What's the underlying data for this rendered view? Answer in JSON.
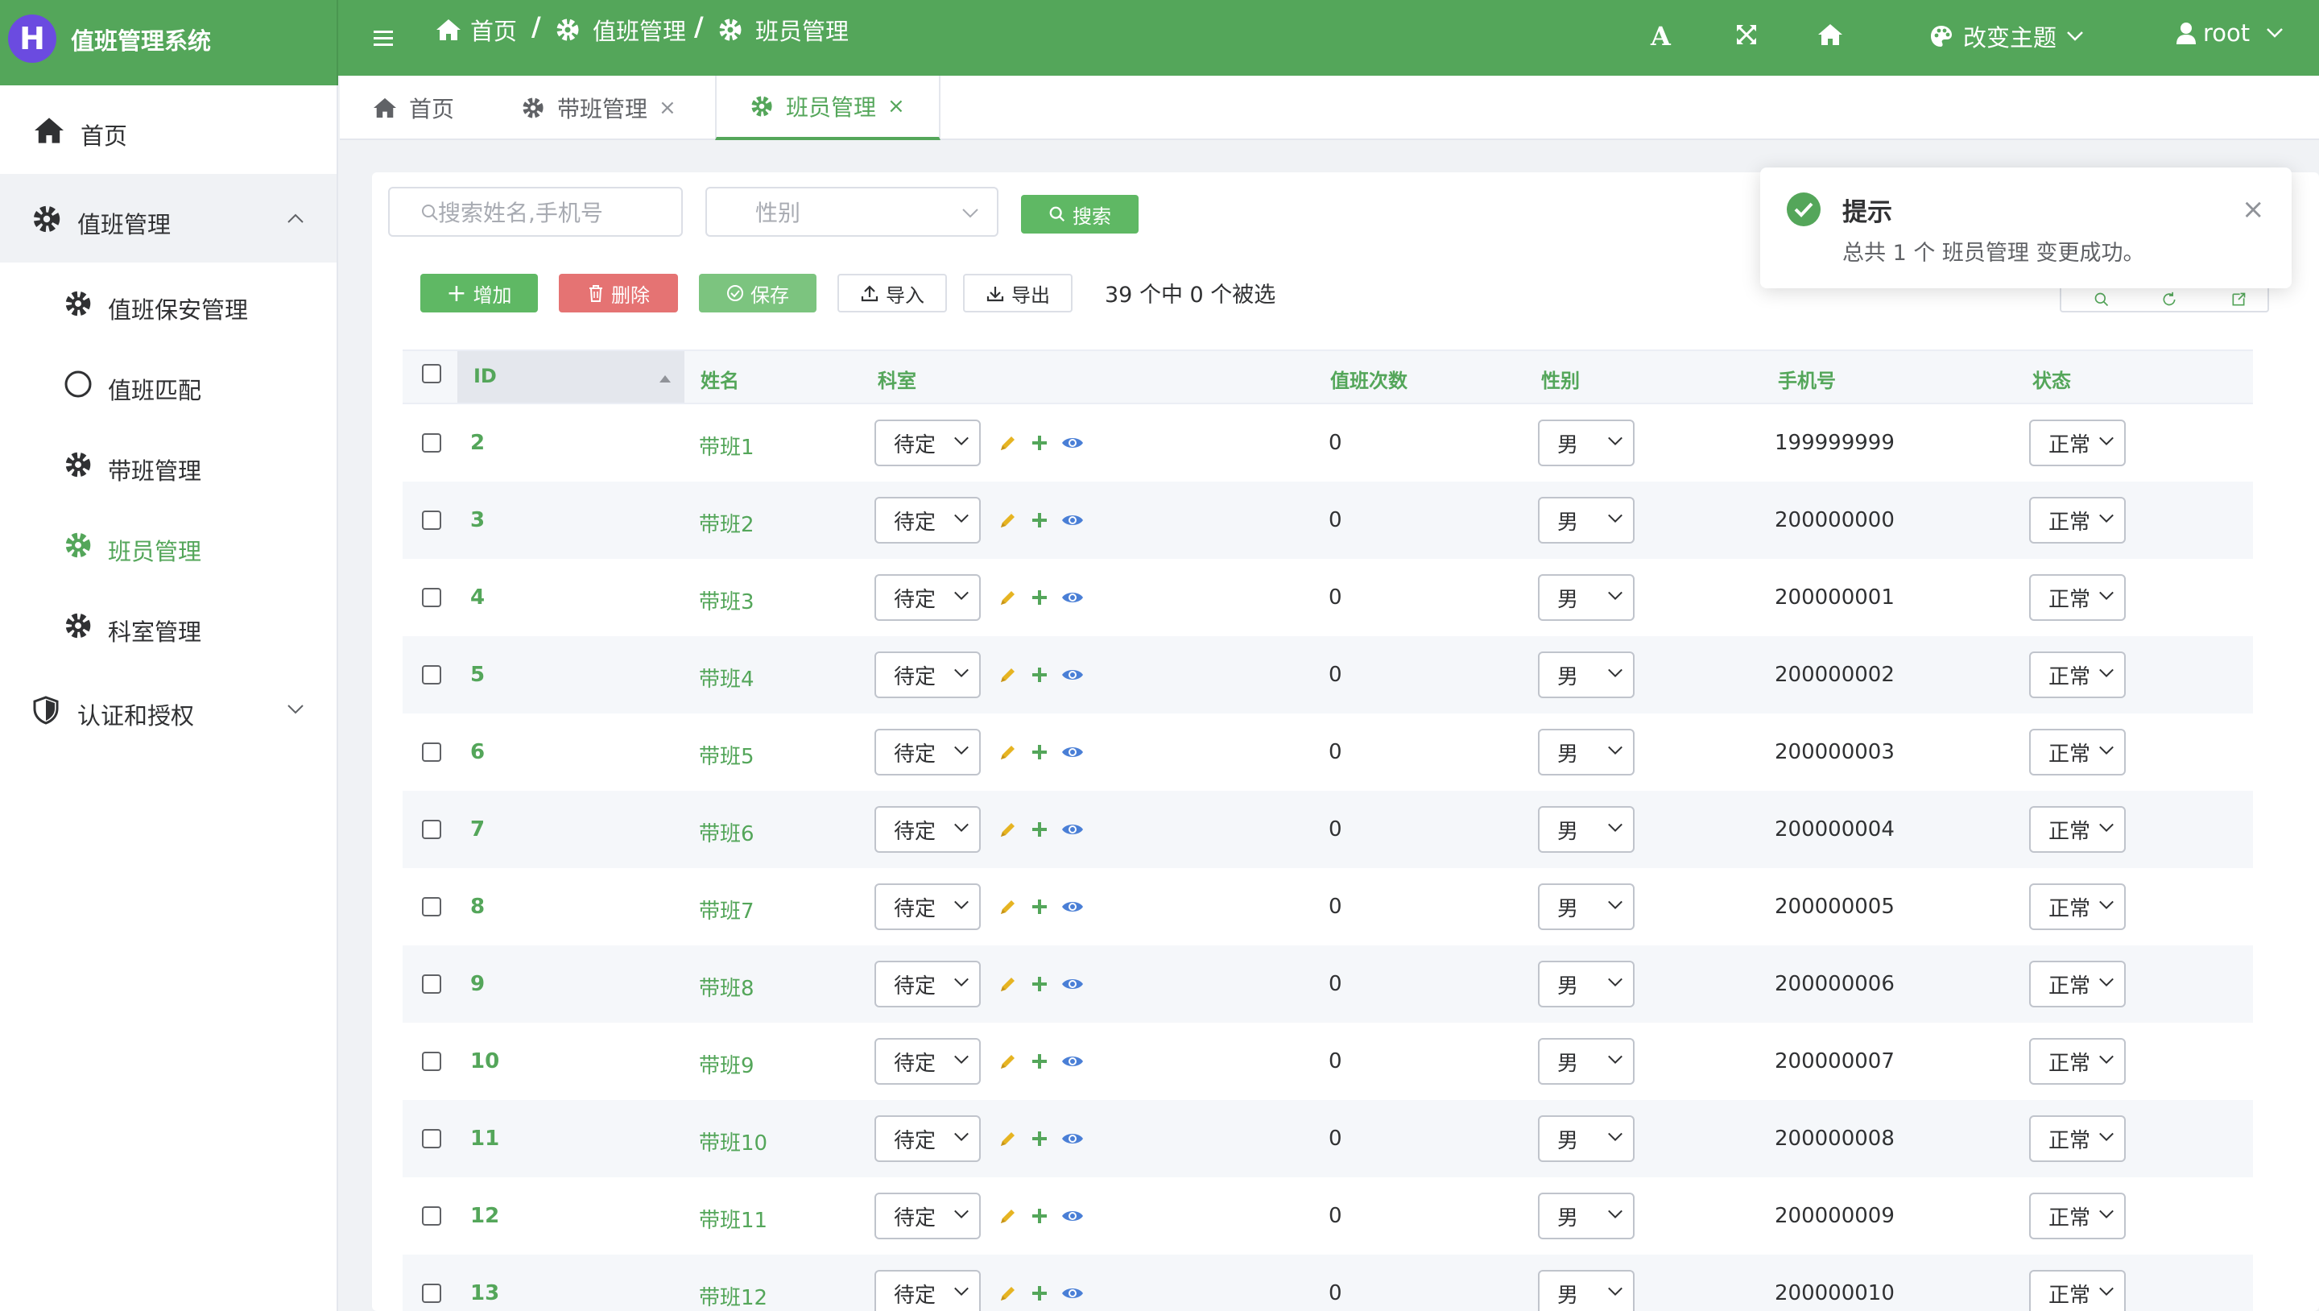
{
  "app": {
    "logo_letter": "H",
    "title": "值班管理系统"
  },
  "header": {
    "breadcrumb": [
      "首页",
      "值班管理",
      "班员管理"
    ],
    "breadcrumb_sep": "/",
    "font_icon_label": "A",
    "theme_label": "改变主题",
    "user_label": "root"
  },
  "sidebar": {
    "home": "首页",
    "group_duty": "值班管理",
    "items": [
      "值班保安管理",
      "值班匹配",
      "带班管理",
      "班员管理",
      "科室管理"
    ],
    "group_auth": "认证和授权"
  },
  "tabs": [
    {
      "label": "首页"
    },
    {
      "label": "带班管理"
    },
    {
      "label": "班员管理"
    }
  ],
  "tab_close": "×",
  "filters": {
    "search_placeholder": "搜索姓名,手机号",
    "gender_placeholder": "性别",
    "search_button": "搜索"
  },
  "actions": {
    "add": "增加",
    "delete": "删除",
    "save": "保存",
    "import": "导入",
    "export": "导出",
    "selection_info": "39 个中 0 个被选"
  },
  "table": {
    "headers": [
      "ID",
      "姓名",
      "科室",
      "值班次数",
      "性别",
      "手机号",
      "状态"
    ],
    "rows": [
      {
        "id": "2",
        "name": "带班1",
        "dept": "待定",
        "count": "0",
        "gender": "男",
        "phone": "199999999",
        "status": "正常"
      },
      {
        "id": "3",
        "name": "带班2",
        "dept": "待定",
        "count": "0",
        "gender": "男",
        "phone": "200000000",
        "status": "正常"
      },
      {
        "id": "4",
        "name": "带班3",
        "dept": "待定",
        "count": "0",
        "gender": "男",
        "phone": "200000001",
        "status": "正常"
      },
      {
        "id": "5",
        "name": "带班4",
        "dept": "待定",
        "count": "0",
        "gender": "男",
        "phone": "200000002",
        "status": "正常"
      },
      {
        "id": "6",
        "name": "带班5",
        "dept": "待定",
        "count": "0",
        "gender": "男",
        "phone": "200000003",
        "status": "正常"
      },
      {
        "id": "7",
        "name": "带班6",
        "dept": "待定",
        "count": "0",
        "gender": "男",
        "phone": "200000004",
        "status": "正常"
      },
      {
        "id": "8",
        "name": "带班7",
        "dept": "待定",
        "count": "0",
        "gender": "男",
        "phone": "200000005",
        "status": "正常"
      },
      {
        "id": "9",
        "name": "带班8",
        "dept": "待定",
        "count": "0",
        "gender": "男",
        "phone": "200000006",
        "status": "正常"
      },
      {
        "id": "10",
        "name": "带班9",
        "dept": "待定",
        "count": "0",
        "gender": "男",
        "phone": "200000007",
        "status": "正常"
      },
      {
        "id": "11",
        "name": "带班10",
        "dept": "待定",
        "count": "0",
        "gender": "男",
        "phone": "200000008",
        "status": "正常"
      },
      {
        "id": "12",
        "name": "带班11",
        "dept": "待定",
        "count": "0",
        "gender": "男",
        "phone": "200000009",
        "status": "正常"
      },
      {
        "id": "13",
        "name": "带班12",
        "dept": "待定",
        "count": "0",
        "gender": "男",
        "phone": "200000010",
        "status": "正常"
      }
    ]
  },
  "toast": {
    "title": "提示",
    "message": "总共 1 个 班员管理 变更成功。",
    "close": "×"
  },
  "colors": {
    "brand_green": "#54a65a",
    "danger": "#e57373",
    "logo_purple": "#6b4be0",
    "edit_icon": "#e6b422",
    "view_icon": "#4a7fd6"
  }
}
